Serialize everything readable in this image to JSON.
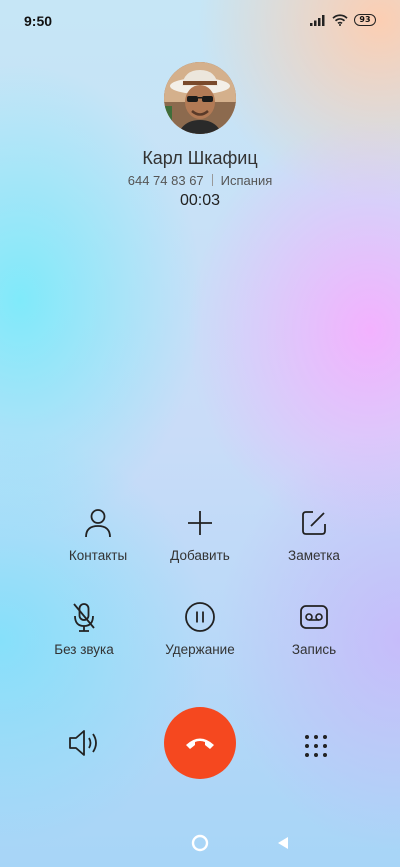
{
  "status_bar": {
    "time": "9:50",
    "battery": "93",
    "icons": [
      "signal-icon",
      "wifi-icon",
      "battery-icon"
    ]
  },
  "contact": {
    "name": "Карл Шкафиц",
    "phone": "644 74 83 67",
    "location": "Испания",
    "duration": "00:03"
  },
  "actions": {
    "contacts": {
      "label": "Контакты",
      "icon": "person-icon"
    },
    "add": {
      "label": "Добавить",
      "icon": "plus-icon"
    },
    "note": {
      "label": "Заметка",
      "icon": "note-edit-icon"
    },
    "mute": {
      "label": "Без звука",
      "icon": "mic-off-icon"
    },
    "hold": {
      "label": "Удержание",
      "icon": "pause-icon"
    },
    "record": {
      "label": "Запись",
      "icon": "record-icon"
    }
  },
  "controls": {
    "speaker_icon": "speaker-icon",
    "end_call_icon": "hang-up-icon",
    "keypad_icon": "keypad-icon",
    "end_call_color": "#f5481f"
  },
  "nav_bar": {
    "icons": [
      "home-icon",
      "back-icon"
    ]
  }
}
